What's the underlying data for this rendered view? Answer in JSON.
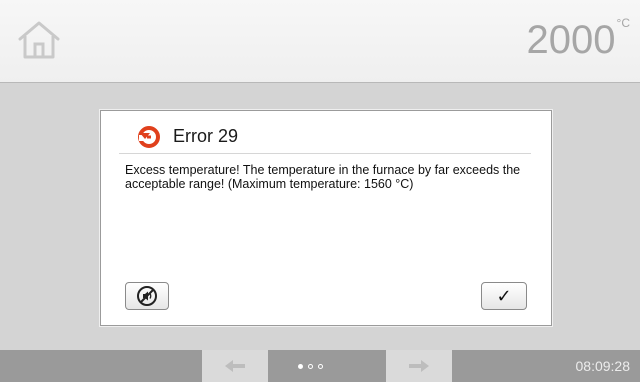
{
  "header": {
    "temperature_value": "2000",
    "temperature_unit": "°C"
  },
  "dialog": {
    "title": "Error 29",
    "message": "Excess temperature! The temperature in the furnace by far exceeds the acceptable range! (Maximum temperature: 1560 °C)",
    "confirm_label": "✓"
  },
  "footer": {
    "time": "08:09:28",
    "page_dots": 3,
    "active_page": 1
  },
  "icons": {
    "home": "home-icon",
    "error": "error-icon",
    "mute": "mute-sound-icon",
    "prev": "arrow-left-icon",
    "next": "arrow-right-icon"
  },
  "colors": {
    "error_accent": "#e0401c",
    "icon_gray": "#c4c4c4"
  }
}
